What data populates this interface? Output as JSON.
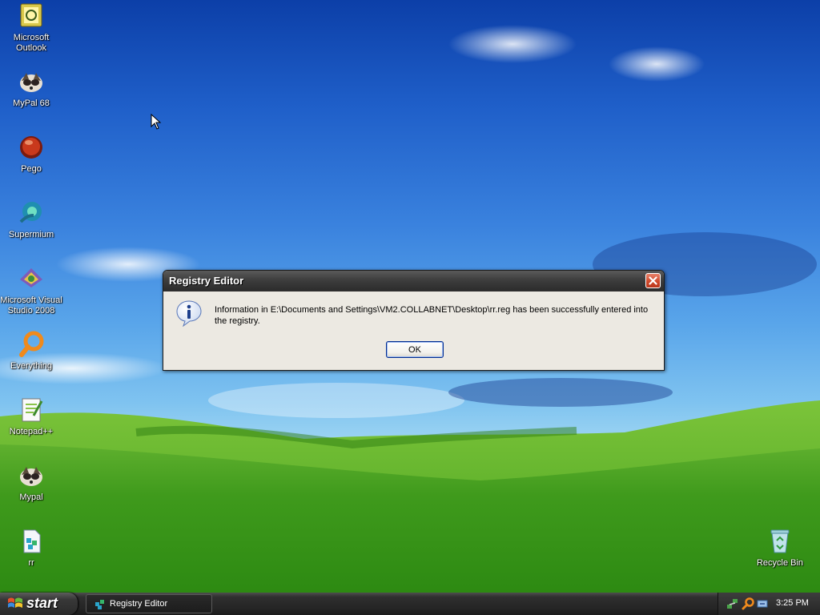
{
  "desktop": {
    "icons": [
      {
        "label": "Microsoft Outlook",
        "icon": "outlook-icon"
      },
      {
        "label": "MyPal 68",
        "icon": "mypal-icon"
      },
      {
        "label": "Pego",
        "icon": "pego-icon"
      },
      {
        "label": "Supermium",
        "icon": "supermium-icon"
      },
      {
        "label": "Microsoft Visual Studio 2008",
        "icon": "visual-studio-icon"
      },
      {
        "label": "Everything",
        "icon": "everything-icon"
      },
      {
        "label": "Notepad++",
        "icon": "notepadpp-icon"
      },
      {
        "label": "Mypal",
        "icon": "mypal-icon"
      },
      {
        "label": "rr",
        "icon": "reg-file-icon"
      },
      {
        "label": "Recycle Bin",
        "icon": "recycle-bin-icon"
      }
    ]
  },
  "dialog": {
    "title": "Registry Editor",
    "message": "Information in E:\\Documents and Settings\\VM2.COLLABNET\\Desktop\\rr.reg has been successfully entered into the registry.",
    "ok_label": "OK",
    "icon": "info-icon"
  },
  "taskbar": {
    "start_label": "start",
    "tasks": [
      {
        "label": "Registry Editor",
        "icon": "registry-editor-icon"
      }
    ],
    "tray_icons": [
      "network-icon",
      "everything-tray-icon",
      "safely-remove-icon"
    ],
    "clock": "3:25 PM"
  },
  "colors": {
    "taskbar": "#252525",
    "dialog_title": "#3d3d3d",
    "dialog_body": "#ece9e2",
    "close_button": "#cf4a2c"
  }
}
